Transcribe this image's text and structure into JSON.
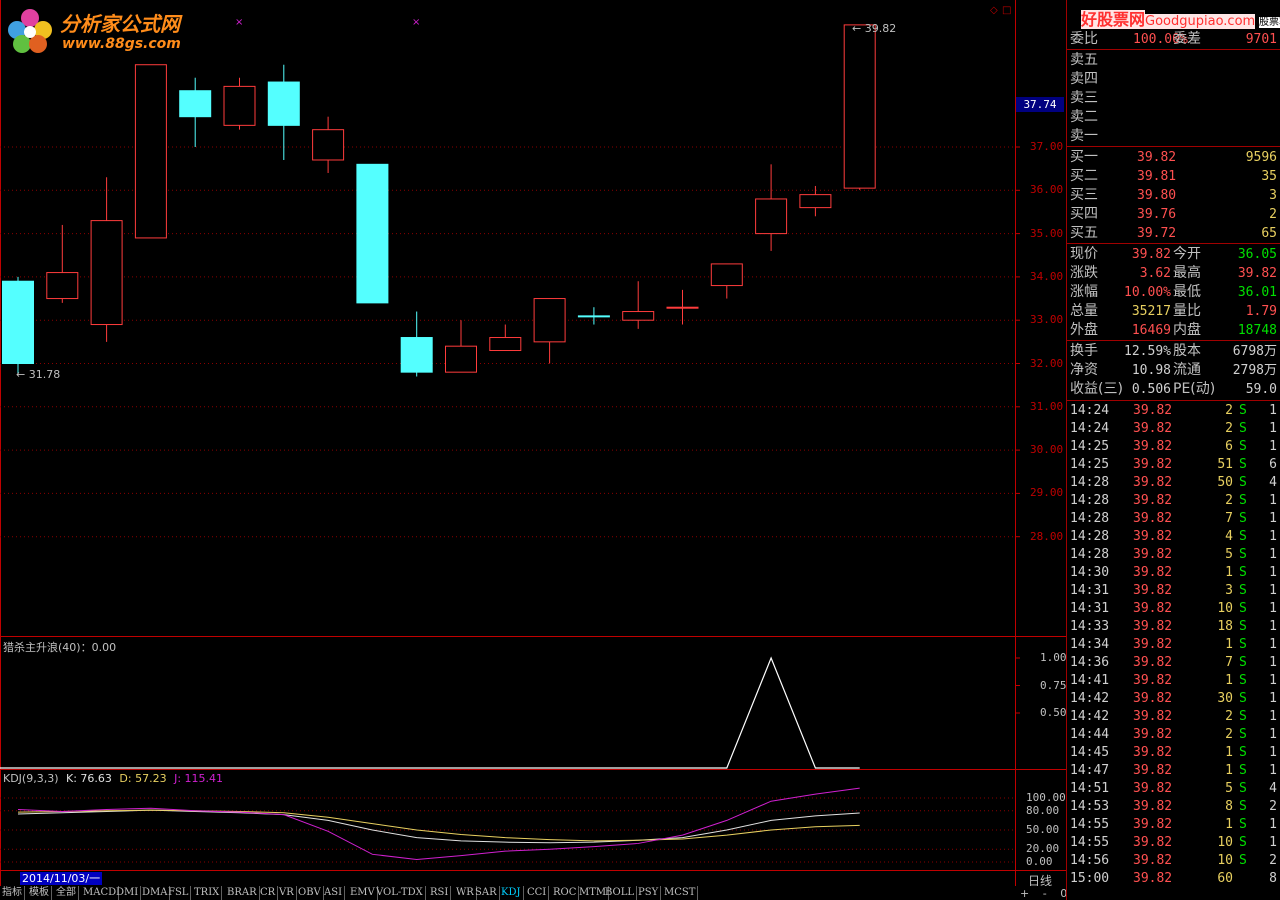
{
  "watermark": {
    "site_cn": "分析家公式网",
    "site_url": "www.88gs.com",
    "right_cn": "好股票网",
    "right_url": "Goodgupiao.com",
    "right_tag": "股票软件公式"
  },
  "price_axis": {
    "labels": [
      "37.00",
      "36.00",
      "35.00",
      "34.00",
      "33.00",
      "32.00",
      "31.00",
      "30.00",
      "29.00",
      "28.00"
    ],
    "current": "37.74",
    "high_marker": "39.82",
    "low_marker": "31.78"
  },
  "chart_data": [
    {
      "type": "candlestick",
      "title": "",
      "candles": [
        {
          "o": 33.9,
          "c": 32.0,
          "h": 34.0,
          "l": 31.78,
          "up": false
        },
        {
          "o": 33.5,
          "c": 34.1,
          "h": 35.2,
          "l": 33.4,
          "up": true
        },
        {
          "o": 32.9,
          "c": 35.3,
          "h": 36.3,
          "l": 32.5,
          "up": true
        },
        {
          "o": 34.9,
          "c": 38.9,
          "h": 38.9,
          "l": 34.9,
          "up": true
        },
        {
          "o": 38.3,
          "c": 37.7,
          "h": 38.6,
          "l": 37.0,
          "up": false
        },
        {
          "o": 37.5,
          "c": 38.4,
          "h": 38.6,
          "l": 37.4,
          "up": true
        },
        {
          "o": 38.5,
          "c": 37.5,
          "h": 38.9,
          "l": 36.7,
          "up": false
        },
        {
          "o": 36.7,
          "c": 37.4,
          "h": 37.7,
          "l": 36.4,
          "up": true
        },
        {
          "o": 36.6,
          "c": 33.4,
          "h": 36.6,
          "l": 33.4,
          "up": false
        },
        {
          "o": 32.6,
          "c": 31.8,
          "h": 33.2,
          "l": 31.7,
          "up": false
        },
        {
          "o": 31.8,
          "c": 32.4,
          "h": 33.0,
          "l": 31.8,
          "up": true
        },
        {
          "o": 32.3,
          "c": 32.6,
          "h": 32.9,
          "l": 32.3,
          "up": true
        },
        {
          "o": 32.5,
          "c": 33.5,
          "h": 33.5,
          "l": 32.0,
          "up": true
        },
        {
          "o": 33.1,
          "c": 33.1,
          "h": 33.3,
          "l": 32.9,
          "up": false
        },
        {
          "o": 33.0,
          "c": 33.2,
          "h": 33.9,
          "l": 32.8,
          "up": true
        },
        {
          "o": 33.3,
          "c": 33.3,
          "h": 33.7,
          "l": 32.9,
          "up": true
        },
        {
          "o": 33.8,
          "c": 34.3,
          "h": 34.3,
          "l": 33.5,
          "up": true
        },
        {
          "o": 35.0,
          "c": 35.8,
          "h": 36.6,
          "l": 34.6,
          "up": true
        },
        {
          "o": 35.6,
          "c": 35.9,
          "h": 36.1,
          "l": 35.4,
          "up": true
        },
        {
          "o": 36.05,
          "c": 39.82,
          "h": 39.82,
          "l": 36.01,
          "up": true
        }
      ]
    },
    {
      "type": "line",
      "title": "猎杀主升浪(40)：0.00",
      "ylim": [
        0,
        1
      ],
      "ticks": [
        "1.00",
        "0.75",
        "0.50"
      ],
      "values": [
        0,
        0,
        0,
        0,
        0,
        0,
        0,
        0,
        0,
        0,
        0,
        0,
        0,
        0,
        0,
        0,
        0,
        1,
        0,
        0
      ]
    },
    {
      "type": "line",
      "title": "KDJ(9,3,3)",
      "k_label": "K: 76.63",
      "d_label": "D: 57.23",
      "j_label": "J: 115.41",
      "ylim": [
        0,
        120
      ],
      "ticks": [
        "100.00",
        "80.00",
        "50.00",
        "20.00",
        "0.00"
      ],
      "series": [
        {
          "name": "K",
          "color": "#e0e0e0",
          "values": [
            75,
            77,
            79,
            81,
            79,
            77,
            74,
            65,
            50,
            38,
            33,
            31,
            30,
            31,
            34,
            38,
            50,
            65,
            72,
            76.63
          ]
        },
        {
          "name": "D",
          "color": "#e8d060",
          "values": [
            78,
            79,
            80,
            81,
            80,
            79,
            77,
            70,
            60,
            50,
            43,
            38,
            35,
            33,
            34,
            36,
            42,
            50,
            55,
            57.23
          ]
        },
        {
          "name": "J",
          "color": "#d020d0",
          "values": [
            82,
            79,
            82,
            84,
            80,
            78,
            74,
            48,
            12,
            4,
            10,
            17,
            20,
            24,
            29,
            42,
            65,
            95,
            106,
            115.41
          ]
        }
      ]
    }
  ],
  "date_tag": "2014/11/03/一",
  "period": "日线",
  "tabs": [
    "指标",
    "模板",
    "全部",
    "MACD",
    "DMI",
    "DMA",
    "FSL",
    "TRIX",
    "BRAR",
    "CR",
    "VR",
    "OBV",
    "ASI",
    "EMV",
    "VOL-TDX",
    "RSI",
    "WR",
    "SAR",
    "KDJ",
    "CCI",
    "ROC",
    "MTM",
    "BOLL",
    "PSY",
    "MCST"
  ],
  "active_tab": "KDJ",
  "scroll_buttons": [
    "+",
    "-",
    "0"
  ],
  "quote": {
    "ratio_label": "委比",
    "ratio": "100.00%",
    "diff_label": "委差",
    "diff": "9701",
    "sell": [
      {
        "label": "卖五"
      },
      {
        "label": "卖四"
      },
      {
        "label": "卖三"
      },
      {
        "label": "卖二"
      },
      {
        "label": "卖一"
      }
    ],
    "buy": [
      {
        "label": "买一",
        "price": "39.82",
        "vol": "9596"
      },
      {
        "label": "买二",
        "price": "39.81",
        "vol": "35"
      },
      {
        "label": "买三",
        "price": "39.80",
        "vol": "3"
      },
      {
        "label": "买四",
        "price": "39.76",
        "vol": "2"
      },
      {
        "label": "买五",
        "price": "39.72",
        "vol": "65"
      }
    ],
    "stats": [
      {
        "l1": "现价",
        "v1": "39.82",
        "c1": "red",
        "l2": "今开",
        "v2": "36.05",
        "c2": "grn"
      },
      {
        "l1": "涨跌",
        "v1": "3.62",
        "c1": "red",
        "l2": "最高",
        "v2": "39.82",
        "c2": "red"
      },
      {
        "l1": "涨幅",
        "v1": "10.00%",
        "c1": "red",
        "l2": "最低",
        "v2": "36.01",
        "c2": "grn"
      },
      {
        "l1": "总量",
        "v1": "35217",
        "c1": "yel",
        "l2": "量比",
        "v2": "1.79",
        "c2": "red"
      },
      {
        "l1": "外盘",
        "v1": "16469",
        "c1": "red",
        "l2": "内盘",
        "v2": "18748",
        "c2": "grn"
      }
    ],
    "fund": [
      {
        "l1": "换手",
        "v1": "12.59%",
        "l2": "股本",
        "v2": "6798万"
      },
      {
        "l1": "净资",
        "v1": "10.98",
        "l2": "流通",
        "v2": "2798万"
      },
      {
        "l1": "收益(三)",
        "v1": "0.506",
        "l2": "PE(动)",
        "v2": "59.0"
      }
    ],
    "ticks": [
      {
        "t": "14:24",
        "p": "39.82",
        "v": "2",
        "s": "S",
        "n": "1"
      },
      {
        "t": "14:24",
        "p": "39.82",
        "v": "2",
        "s": "S",
        "n": "1"
      },
      {
        "t": "14:25",
        "p": "39.82",
        "v": "6",
        "s": "S",
        "n": "1"
      },
      {
        "t": "14:25",
        "p": "39.82",
        "v": "51",
        "s": "S",
        "n": "6"
      },
      {
        "t": "14:28",
        "p": "39.82",
        "v": "50",
        "s": "S",
        "n": "4"
      },
      {
        "t": "14:28",
        "p": "39.82",
        "v": "2",
        "s": "S",
        "n": "1"
      },
      {
        "t": "14:28",
        "p": "39.82",
        "v": "7",
        "s": "S",
        "n": "1"
      },
      {
        "t": "14:28",
        "p": "39.82",
        "v": "4",
        "s": "S",
        "n": "1"
      },
      {
        "t": "14:28",
        "p": "39.82",
        "v": "5",
        "s": "S",
        "n": "1"
      },
      {
        "t": "14:30",
        "p": "39.82",
        "v": "1",
        "s": "S",
        "n": "1"
      },
      {
        "t": "14:31",
        "p": "39.82",
        "v": "3",
        "s": "S",
        "n": "1"
      },
      {
        "t": "14:31",
        "p": "39.82",
        "v": "10",
        "s": "S",
        "n": "1"
      },
      {
        "t": "14:33",
        "p": "39.82",
        "v": "18",
        "s": "S",
        "n": "1"
      },
      {
        "t": "14:34",
        "p": "39.82",
        "v": "1",
        "s": "S",
        "n": "1"
      },
      {
        "t": "14:36",
        "p": "39.82",
        "v": "7",
        "s": "S",
        "n": "1"
      },
      {
        "t": "14:41",
        "p": "39.82",
        "v": "1",
        "s": "S",
        "n": "1"
      },
      {
        "t": "14:42",
        "p": "39.82",
        "v": "30",
        "s": "S",
        "n": "1"
      },
      {
        "t": "14:42",
        "p": "39.82",
        "v": "2",
        "s": "S",
        "n": "1"
      },
      {
        "t": "14:44",
        "p": "39.82",
        "v": "2",
        "s": "S",
        "n": "1"
      },
      {
        "t": "14:45",
        "p": "39.82",
        "v": "1",
        "s": "S",
        "n": "1"
      },
      {
        "t": "14:47",
        "p": "39.82",
        "v": "1",
        "s": "S",
        "n": "1"
      },
      {
        "t": "14:51",
        "p": "39.82",
        "v": "5",
        "s": "S",
        "n": "4"
      },
      {
        "t": "14:53",
        "p": "39.82",
        "v": "8",
        "s": "S",
        "n": "2"
      },
      {
        "t": "14:55",
        "p": "39.82",
        "v": "1",
        "s": "S",
        "n": "1"
      },
      {
        "t": "14:55",
        "p": "39.82",
        "v": "10",
        "s": "S",
        "n": "1"
      },
      {
        "t": "14:56",
        "p": "39.82",
        "v": "10",
        "s": "S",
        "n": "2"
      },
      {
        "t": "15:00",
        "p": "39.82",
        "v": "60",
        "s": "",
        "n": "8"
      }
    ]
  },
  "colors": {
    "up": "#ff3c3c",
    "down": "#54ffff",
    "grid": "#a00000",
    "border": "#c00000"
  }
}
